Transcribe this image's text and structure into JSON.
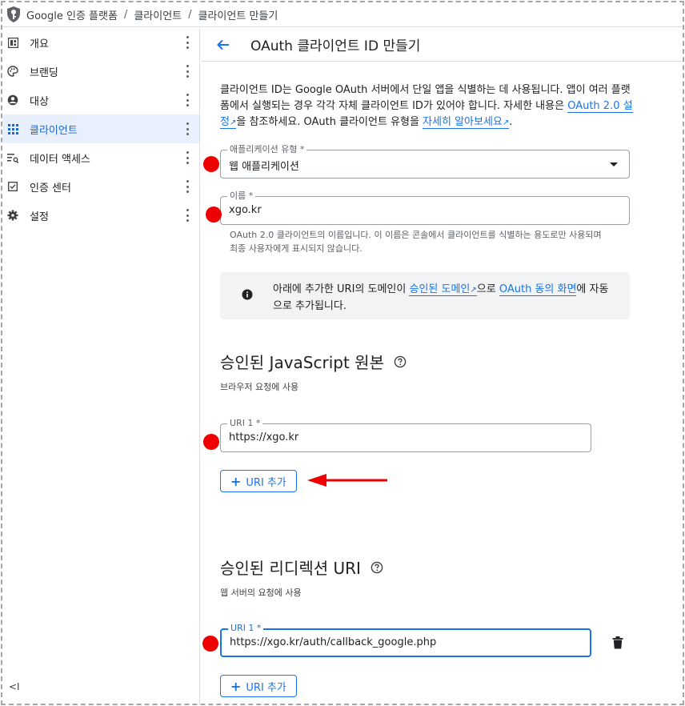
{
  "breadcrumb": {
    "items": [
      "Google 인증 플랫폼",
      "클라이언트",
      "클라이언트 만들기"
    ],
    "separator": "/"
  },
  "sidebar": {
    "items": [
      {
        "label": "개요",
        "icon": "dashboard-icon",
        "active": false
      },
      {
        "label": "브랜딩",
        "icon": "palette-icon",
        "active": false
      },
      {
        "label": "대상",
        "icon": "account-circle-icon",
        "active": false
      },
      {
        "label": "클라이언트",
        "icon": "apps-grid-icon",
        "active": true
      },
      {
        "label": "데이터 액세스",
        "icon": "data-access-icon",
        "active": false
      },
      {
        "label": "인증 센터",
        "icon": "verified-checkbox-icon",
        "active": false
      },
      {
        "label": "설정",
        "icon": "gear-icon",
        "active": false
      }
    ],
    "collapse_label": "<I"
  },
  "page": {
    "title": "OAuth 클라이언트 ID 만들기"
  },
  "intro": {
    "text1": "클라이언트 ID는 Google OAuth 서버에서 단일 앱을 식별하는 데 사용됩니다. 앱이 여러 플랫폼에서 실행되는 경우 각각 자체 클라이언트 ID가 있어야 합니다. 자세한 내용은 ",
    "link1": "OAuth 2.0 설정",
    "text2": "을 참조하세요. OAuth 클라이언트 유형을 ",
    "link2": "자세히 알아보세요",
    "text3": "."
  },
  "app_type": {
    "label": "애플리케이션 유형 *",
    "value": "웹 애플리케이션"
  },
  "name_field": {
    "label": "이름 *",
    "value": "xgo.kr",
    "help": "OAuth 2.0 클라이언트의 이름입니다. 이 이름은 콘솔에서 클라이언트를 식별하는 용도로만 사용되며 최종 사용자에게 표시되지 않습니다."
  },
  "info": {
    "text1": "아래에 추가한 URI의 도메인이 ",
    "link1": "승인된 도메인",
    "text2": "으로 ",
    "link2": "OAuth 동의 화면",
    "text3": "에 자동으로 추가됩니다."
  },
  "js_origins": {
    "title": "승인된 JavaScript 원본",
    "subtitle": "브라우저 요청에 사용",
    "uri_label": "URI 1 *",
    "uri_value": "https://xgo.kr",
    "add_label": "URI 추가"
  },
  "redirect_uris": {
    "title": "승인된 리디렉션 URI",
    "subtitle": "웹 서버의 요청에 사용",
    "uri_label": "URI 1 *",
    "uri_value": "https://xgo.kr/auth/callback_google.php",
    "add_label": "URI 추가"
  },
  "colors": {
    "accent": "#1a73e8",
    "active_bg": "#e8f0fe",
    "marker": "#ee0000"
  }
}
